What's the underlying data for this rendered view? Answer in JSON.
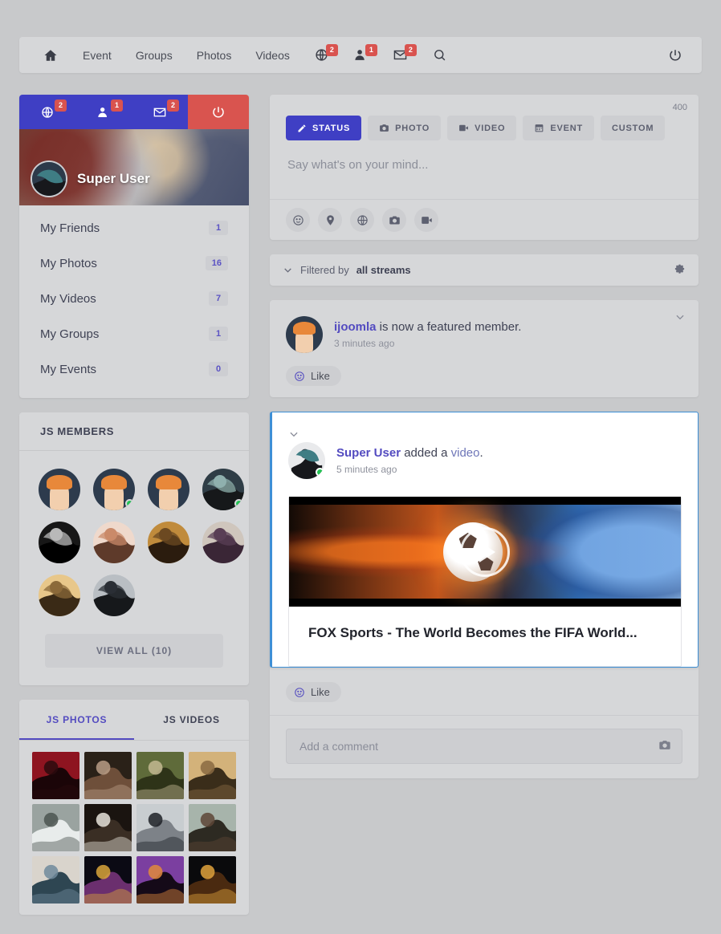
{
  "topnav": {
    "items": [
      {
        "label": "",
        "icon": "home-icon",
        "name": "nav-home"
      },
      {
        "label": "Event",
        "icon": "",
        "name": "nav-event"
      },
      {
        "label": "Groups",
        "icon": "",
        "name": "nav-groups"
      },
      {
        "label": "Photos",
        "icon": "",
        "name": "nav-photos"
      },
      {
        "label": "Videos",
        "icon": "",
        "name": "nav-videos"
      }
    ],
    "notifications": [
      {
        "icon": "globe-icon",
        "badge": "2",
        "name": "nav-notifications"
      },
      {
        "icon": "friend-request-icon",
        "badge": "1",
        "name": "nav-friend-requests"
      },
      {
        "icon": "envelope-icon",
        "badge": "2",
        "name": "nav-messages"
      }
    ],
    "search_icon": "search-icon",
    "power_icon": "power-icon"
  },
  "profile": {
    "quicknav": [
      {
        "icon": "globe-icon",
        "badge": "2"
      },
      {
        "icon": "friend-request-icon",
        "badge": "1"
      },
      {
        "icon": "envelope-icon",
        "badge": "2"
      }
    ],
    "logout_icon": "power-icon",
    "name": "Super User",
    "accent_color": "#3f3fc4",
    "logout_color": "#d9544f"
  },
  "menu": {
    "items": [
      {
        "label": "My Friends",
        "count": "1"
      },
      {
        "label": "My Photos",
        "count": "16"
      },
      {
        "label": "My Videos",
        "count": "7"
      },
      {
        "label": "My Groups",
        "count": "1"
      },
      {
        "label": "My Events",
        "count": "0"
      }
    ]
  },
  "members": {
    "title": "JS MEMBERS",
    "view_all_label": "VIEW ALL (10)",
    "avatars": [
      {
        "type": "cartoon",
        "online": false
      },
      {
        "type": "cartoon",
        "online": true
      },
      {
        "type": "cartoon",
        "online": false
      },
      {
        "type": "photo",
        "online": true,
        "c1": "#2f3d46",
        "c2": "#8fb0ae",
        "c3": "#16181a"
      },
      {
        "type": "photo",
        "online": false,
        "c1": "#171717",
        "c2": "#b9b9b9",
        "c3": "#000000"
      },
      {
        "type": "photo",
        "online": false,
        "c1": "#efd9cc",
        "c2": "#c98a6a",
        "c3": "#5e3a2a"
      },
      {
        "type": "photo",
        "online": false,
        "c1": "#c08b3c",
        "c2": "#6c4a22",
        "c3": "#2b1c0e"
      },
      {
        "type": "photo",
        "online": false,
        "c1": "#cfc6bd",
        "c2": "#5a3f55",
        "c3": "#3a2636"
      },
      {
        "type": "photo",
        "online": false,
        "c1": "#e8c78a",
        "c2": "#8b6a3a",
        "c3": "#3a2a16"
      },
      {
        "type": "photo",
        "online": false,
        "c1": "#b9bec3",
        "c2": "#2b2f35",
        "c3": "#16181b"
      }
    ]
  },
  "photo_tabs": {
    "tabs": [
      {
        "label": "JS PHOTOS",
        "active": true
      },
      {
        "label": "JS VIDEOS",
        "active": false
      }
    ],
    "photos": [
      {
        "c1": "#8e1420",
        "c2": "#2b0a0e",
        "c3": "#1b0508"
      },
      {
        "c1": "#2a2118",
        "c2": "#b99c86",
        "c3": "#6e4f3a"
      },
      {
        "c1": "#5f6b3a",
        "c2": "#c3b892",
        "c3": "#2e3318"
      },
      {
        "c1": "#d3b27a",
        "c2": "#8a6a42",
        "c3": "#3a2d1a"
      },
      {
        "c1": "#9aa3a0",
        "c2": "#4b5550",
        "c3": "#e8eceb"
      },
      {
        "c1": "#1a1410",
        "c2": "#e7e3da",
        "c3": "#3a2e24"
      },
      {
        "c1": "#c8cdd0",
        "c2": "#1d2127",
        "c3": "#7d8288"
      },
      {
        "c1": "#a7b4ab",
        "c2": "#5d4536",
        "c3": "#2d2a22"
      },
      {
        "c1": "#d9d4cc",
        "c2": "#6f8a9b",
        "c3": "#2e4652"
      },
      {
        "c1": "#0b0a14",
        "c2": "#d9a43a",
        "c3": "#6b2f6e"
      },
      {
        "c1": "#7b3fa0",
        "c2": "#e08a3c",
        "c3": "#150a18"
      },
      {
        "c1": "#0a0a0c",
        "c2": "#e0a23c",
        "c3": "#4a2a10"
      }
    ]
  },
  "composer": {
    "char_count": "400",
    "tabs": [
      {
        "label": "STATUS",
        "icon": "pencil-icon",
        "active": true
      },
      {
        "label": "PHOTO",
        "icon": "camera-icon",
        "active": false
      },
      {
        "label": "VIDEO",
        "icon": "video-icon",
        "active": false
      },
      {
        "label": "EVENT",
        "icon": "calendar-icon",
        "active": false
      },
      {
        "label": "CUSTOM",
        "icon": "",
        "active": false
      }
    ],
    "placeholder": "Say what's on your mind...",
    "tools": [
      {
        "icon": "smiley-icon",
        "name": "emoji-button"
      },
      {
        "icon": "location-pin-icon",
        "name": "location-button"
      },
      {
        "icon": "globe-icon",
        "name": "privacy-button"
      },
      {
        "icon": "camera-icon",
        "name": "photo-button"
      },
      {
        "icon": "video-icon",
        "name": "video-button"
      }
    ]
  },
  "filter": {
    "prefix": "Filtered by",
    "value": "all streams",
    "chevron_icon": "chevron-down-icon",
    "gear_icon": "gear-icon"
  },
  "feed": {
    "posts": [
      {
        "author": "ijoomla",
        "text_after": " is now a featured member.",
        "link_text": "",
        "text_tail": "",
        "time": "3 minutes ago",
        "like_label": "Like",
        "highlighted": false
      },
      {
        "author": "Super User",
        "text_after": " added a ",
        "link_text": "video",
        "text_tail": ".",
        "time": "5 minutes ago",
        "like_label": "Like",
        "highlighted": true,
        "video": {
          "title": "FOX Sports - The World Becomes the FIFA World...",
          "play_icon": "play-icon"
        },
        "comment_placeholder": "Add a comment",
        "comment_camera_icon": "camera-icon"
      }
    ]
  }
}
